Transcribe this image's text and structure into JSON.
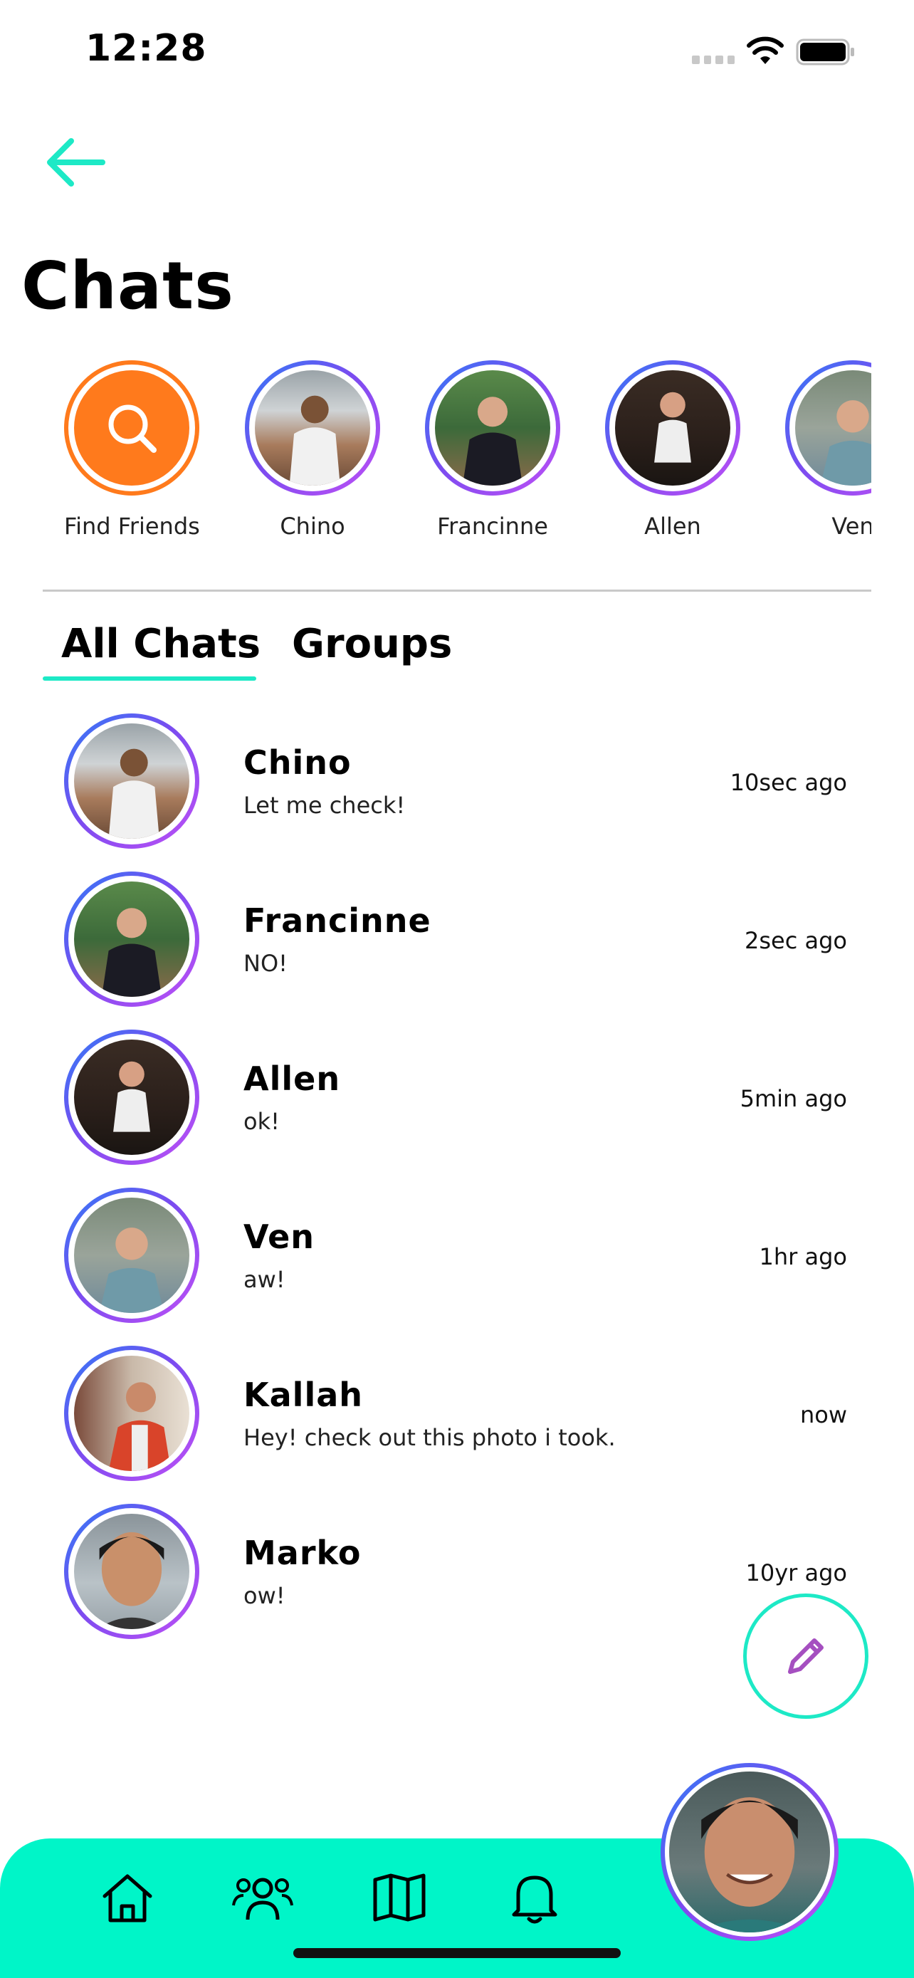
{
  "status_bar": {
    "time": "12:28"
  },
  "header": {
    "title": "Chats"
  },
  "stories": [
    {
      "label": "Find Friends",
      "type": "search"
    },
    {
      "label": "Chino"
    },
    {
      "label": "Francinne"
    },
    {
      "label": "Allen"
    },
    {
      "label": "Ven"
    }
  ],
  "tabs": [
    {
      "label": "All Chats",
      "active": true
    },
    {
      "label": "Groups",
      "active": false
    }
  ],
  "chats": [
    {
      "name": "Chino",
      "message": "Let me check!",
      "time": "10sec ago"
    },
    {
      "name": "Francinne",
      "message": "NO!",
      "time": "2sec ago"
    },
    {
      "name": "Allen",
      "message": "ok!",
      "time": "5min ago"
    },
    {
      "name": "Ven",
      "message": "aw!",
      "time": "1hr ago"
    },
    {
      "name": "Kallah",
      "message": "Hey! check out this photo i took.",
      "time": "now"
    },
    {
      "name": "Marko",
      "message": "ow!",
      "time": "10yr ago"
    }
  ],
  "nav": {
    "items": [
      "home-icon",
      "friends-icon",
      "map-icon",
      "bell-icon"
    ]
  },
  "colors": {
    "accent": "#1de9c6",
    "nav_bg": "#00f5c8",
    "find_friends": "#ff7a1c",
    "compose_icon": "#a54fc0"
  }
}
